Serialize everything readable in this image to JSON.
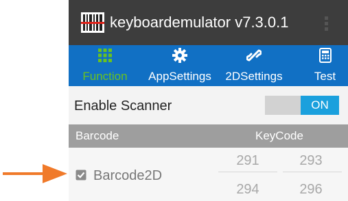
{
  "app": {
    "title": "keyboardemulator v7.3.0.1"
  },
  "tabs": [
    {
      "label": "Function",
      "icon": "grid-icon",
      "active": true
    },
    {
      "label": "AppSettings",
      "icon": "gear-icon",
      "active": false
    },
    {
      "label": "2DSettings",
      "icon": "link-icon",
      "active": false
    },
    {
      "label": "Test",
      "icon": "calculator-icon",
      "active": false
    }
  ],
  "enable": {
    "label": "Enable Scanner",
    "toggle_text": "ON"
  },
  "table": {
    "headers": {
      "barcode": "Barcode",
      "keycode": "KeyCode"
    },
    "row": {
      "label": "Barcode2D",
      "checked": true,
      "codes": [
        "291",
        "293",
        "294",
        "296"
      ]
    }
  },
  "colors": {
    "tabbar": "#1170c4",
    "active_tab": "#6ac21f",
    "toggle_on": "#1aa0dd",
    "arrow": "#f07a2a"
  }
}
